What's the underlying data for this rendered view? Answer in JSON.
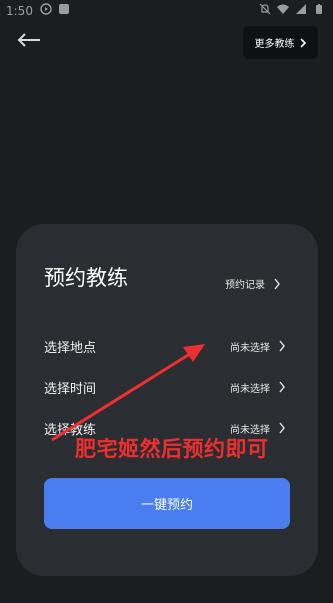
{
  "status_bar": {
    "time": "1:50",
    "left_icons": [
      "media-icon",
      "app-icon"
    ],
    "right_icons": [
      "mute-icon",
      "wifi-icon",
      "signal-icon",
      "battery-icon"
    ]
  },
  "header": {
    "more_coaches_label": "更多教练"
  },
  "sheet": {
    "title": "预约教练",
    "records_label": "预约记录",
    "rows": [
      {
        "label": "选择地点",
        "value": "尚未选择"
      },
      {
        "label": "选择时间",
        "value": "尚未选择"
      },
      {
        "label": "选择教练",
        "value": "尚未选择"
      }
    ],
    "book_button_label": "一键预约"
  },
  "annotation": {
    "text": "肥宅姬然后预约即可",
    "color": "#ee2f30"
  },
  "colors": {
    "background": "#1b1d20",
    "sheet": "#2a2d31",
    "accent": "#4a7ef0"
  }
}
